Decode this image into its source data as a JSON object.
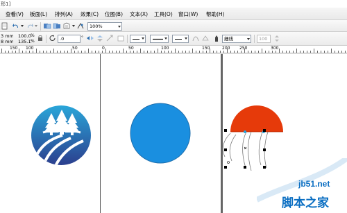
{
  "window": {
    "title": "形1]"
  },
  "menubar": {
    "items": [
      "查看(V)",
      "板面(L)",
      "排列(A)",
      "效果(C)",
      "位图(B)",
      "文本(X)",
      "工具(O)",
      "窗口(W)",
      "帮助(H)"
    ]
  },
  "toolbar": {
    "zoom_value": "100%"
  },
  "property_bar": {
    "width_value": "3 mm",
    "height_value": "8 mm",
    "scale_x": "100.0",
    "scale_y": "135.1",
    "pct_x": "%",
    "pct_y": "%",
    "rotation_value": ".0",
    "outline_width_label": "细线",
    "outline_width_value": "100"
  },
  "ruler": {
    "labels": [
      "150",
      "100",
      "50",
      "0",
      "50",
      "100",
      "150",
      "200",
      "250",
      "300"
    ]
  },
  "watermark": {
    "site": "jb51.net",
    "name": "脚本之家"
  },
  "colors": {
    "logo_blue_top": "#2aa6d9",
    "logo_blue_bottom": "#2b3f8e",
    "circle_blue": "#1a8fe0",
    "semicircle_orange": "#e63a0a",
    "selection_cyan": "#27a7e0",
    "watermark_blue": "#0a6ec2"
  },
  "icons": [
    "undo-icon",
    "redo-icon",
    "import-icon",
    "export-icon",
    "print-icon",
    "zoom-dropdown",
    "rotate-icon",
    "mirror-h-icon",
    "mirror-v-icon",
    "outline-pen-icon"
  ]
}
